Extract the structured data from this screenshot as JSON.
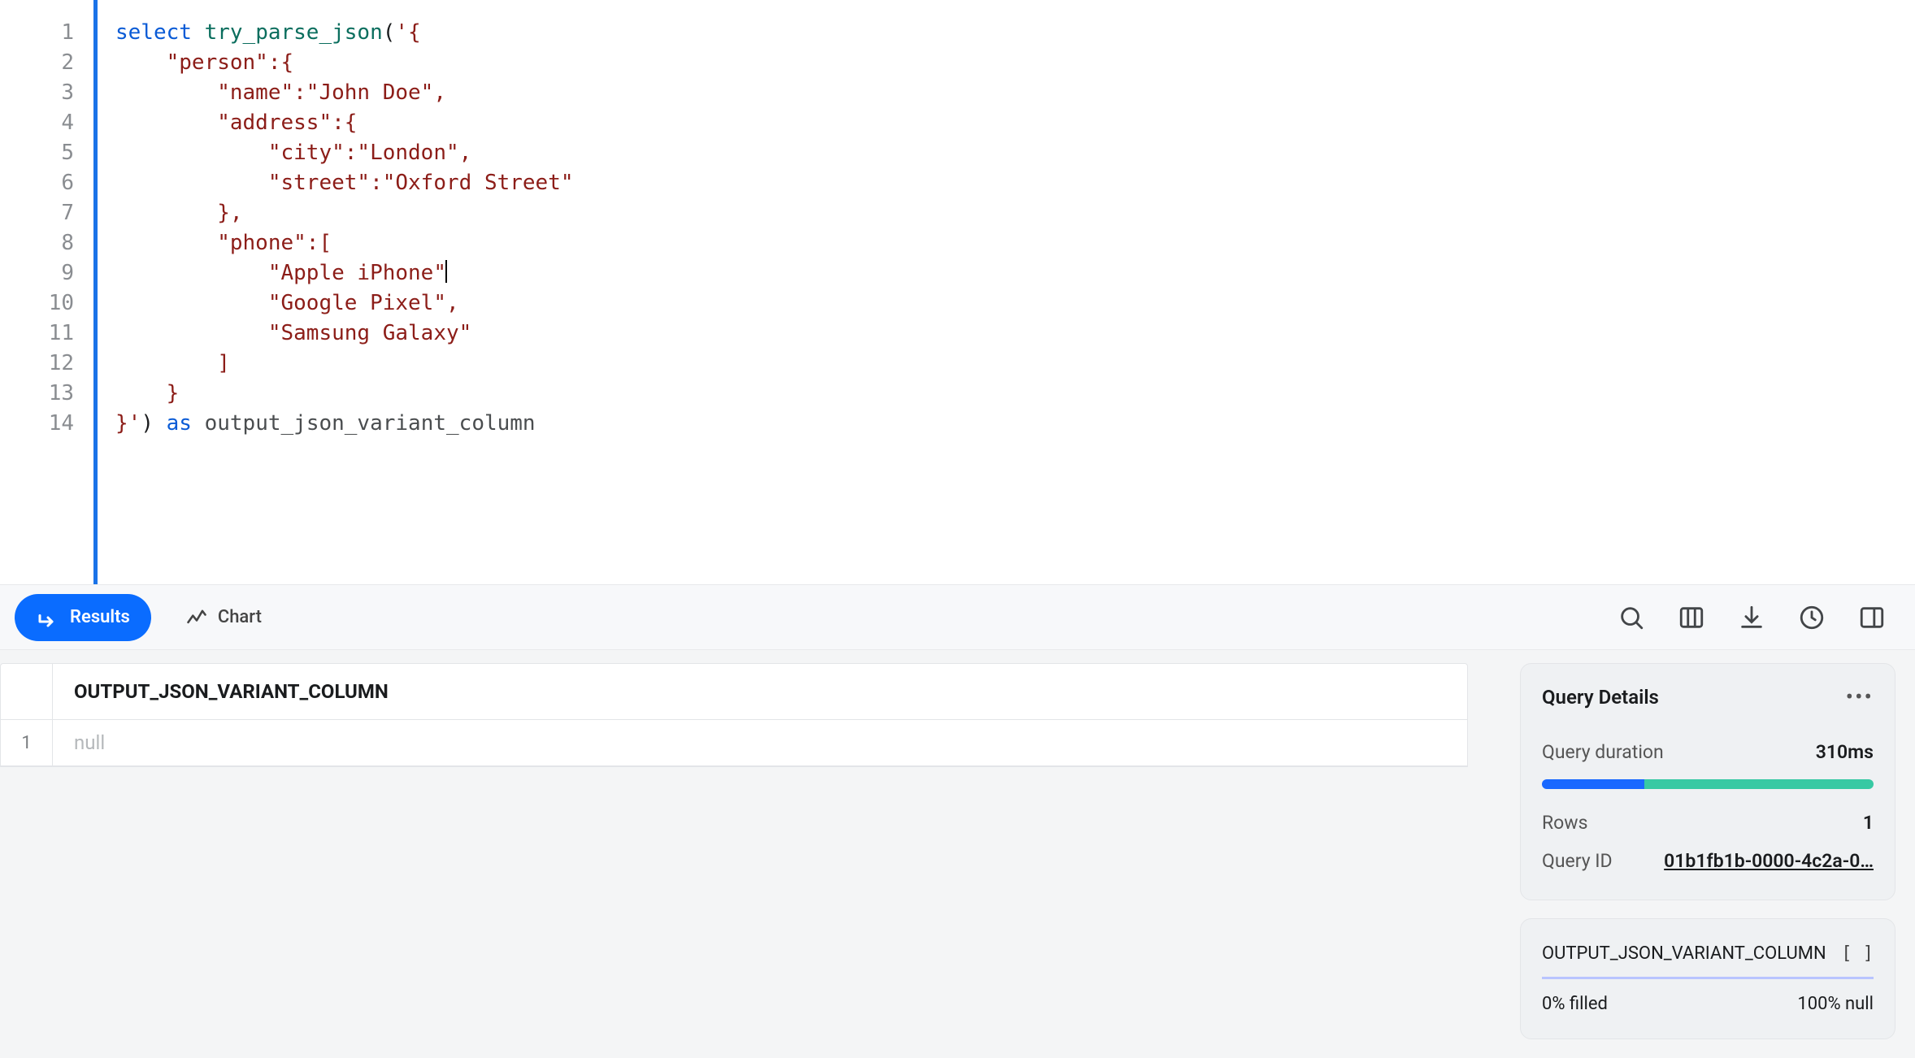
{
  "editor": {
    "line_numbers": [
      "1",
      "2",
      "3",
      "4",
      "5",
      "6",
      "7",
      "8",
      "9",
      "10",
      "11",
      "12",
      "13",
      "14"
    ],
    "t": {
      "kw_select": "select",
      "fn": "try_parse_json",
      "paren_l": "(",
      "s1": "'{",
      "s2": "    \"person\":{",
      "s3": "        \"name\":\"John Doe\",",
      "s4": "        \"address\":{",
      "s5": "            \"city\":\"London\",",
      "s6": "            \"street\":\"Oxford Street\"",
      "s7": "        },",
      "s8": "        \"phone\":[",
      "s9": "            \"Apple iPhone\"",
      "s10": "            \"Google Pixel\",",
      "s11": "            \"Samsung Galaxy\"",
      "s12": "        ]",
      "s13": "    }",
      "s14a": "}'",
      "paren_r": ")",
      "kw_as": "as",
      "ident": "output_json_variant_column"
    }
  },
  "tabs": {
    "results_label": "Results",
    "chart_label": "Chart"
  },
  "results": {
    "columns": [
      "OUTPUT_JSON_VARIANT_COLUMN"
    ],
    "rows": [
      {
        "n": "1",
        "cells": [
          "null"
        ]
      }
    ]
  },
  "details": {
    "title": "Query Details",
    "duration_label": "Query duration",
    "duration_value": "310ms",
    "progress_split_pct": 31,
    "rows_label": "Rows",
    "rows_value": "1",
    "query_id_label": "Query ID",
    "query_id_value": "01b1fb1b-0000-4c2a-0…",
    "column_name": "OUTPUT_JSON_VARIANT_COLUMN",
    "column_type_chip": "[ ]",
    "filled_label": "0% filled",
    "null_label": "100% null"
  }
}
